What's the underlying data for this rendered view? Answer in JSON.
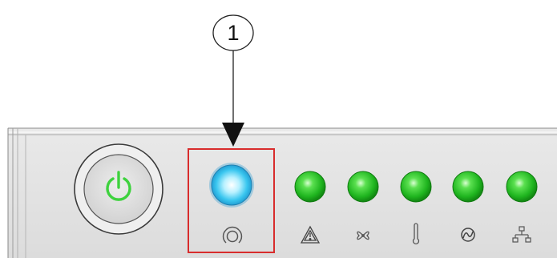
{
  "callout": {
    "number": "1"
  },
  "panel": {
    "highlight_color": "#d82c2c",
    "power_button": {
      "icon": "power-icon",
      "icon_color": "#3ed23e"
    },
    "highlighted_led": {
      "color": "#3cc8f0",
      "icon": "locator-icon"
    },
    "status_leds": [
      {
        "color": "#22c422",
        "icon": "warning-icon"
      },
      {
        "color": "#22c422",
        "icon": "fan-icon"
      },
      {
        "color": "#22c422",
        "icon": "thermometer-icon"
      },
      {
        "color": "#22c422",
        "icon": "power-supply-icon"
      },
      {
        "color": "#22c422",
        "icon": "network-icon"
      }
    ]
  }
}
